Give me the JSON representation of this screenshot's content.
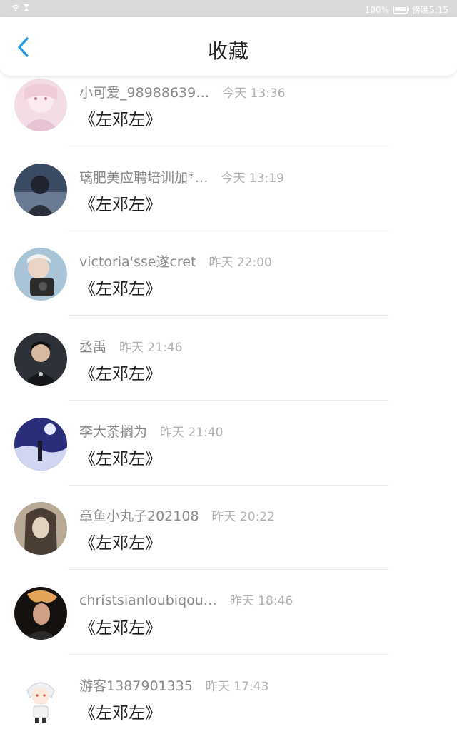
{
  "status_bar": {
    "battery_text": "100%",
    "time": "傍晚5:15"
  },
  "header": {
    "title": "收藏"
  },
  "items": [
    {
      "username": "小可爱_98988639…",
      "time": "今天 13:36",
      "title": "《左邓左》"
    },
    {
      "username": "璃肥美应聘培训加*…",
      "time": "今天 13:19",
      "title": "《左邓左》"
    },
    {
      "username": "victoria'sse遂cret",
      "time": "昨天 22:00",
      "title": "《左邓左》"
    },
    {
      "username": "丞禹",
      "time": "昨天 21:46",
      "title": "《左邓左》"
    },
    {
      "username": "李大荼搁为",
      "time": "昨天 21:40",
      "title": "《左邓左》"
    },
    {
      "username": "章鱼小丸子202108",
      "time": "昨天 20:22",
      "title": "《左邓左》"
    },
    {
      "username": "christsianloubiqou…",
      "time": "昨天 18:46",
      "title": "《左邓左》"
    },
    {
      "username": "游客1387901335",
      "time": "昨天 17:43",
      "title": "《左邓左》"
    }
  ],
  "colors": {
    "accent": "#1e9be8",
    "status_bar": "#d9d9d9",
    "username": "#8a8a8a",
    "time": "#b0b0b0",
    "title": "#222222"
  }
}
